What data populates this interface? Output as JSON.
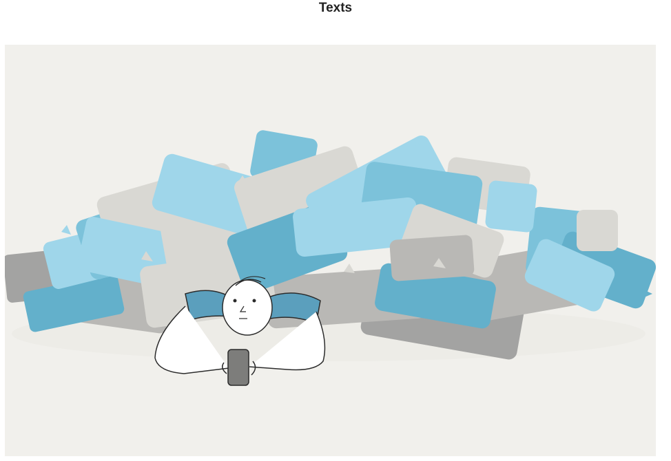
{
  "header": {
    "title": "Texts"
  },
  "illustration": {
    "colors": {
      "background": "#f1f0ec",
      "bubble_blue_light": "#9fd6ea",
      "bubble_blue": "#7cc2da",
      "bubble_blue_dark": "#63b0cb",
      "bubble_grey_light": "#d9d8d3",
      "bubble_grey": "#b9b8b5",
      "bubble_grey_dark": "#a3a3a2",
      "shirt_blue": "#5b9fbd",
      "outline": "#2b2b2b",
      "phone": "#7d7d7b"
    }
  }
}
